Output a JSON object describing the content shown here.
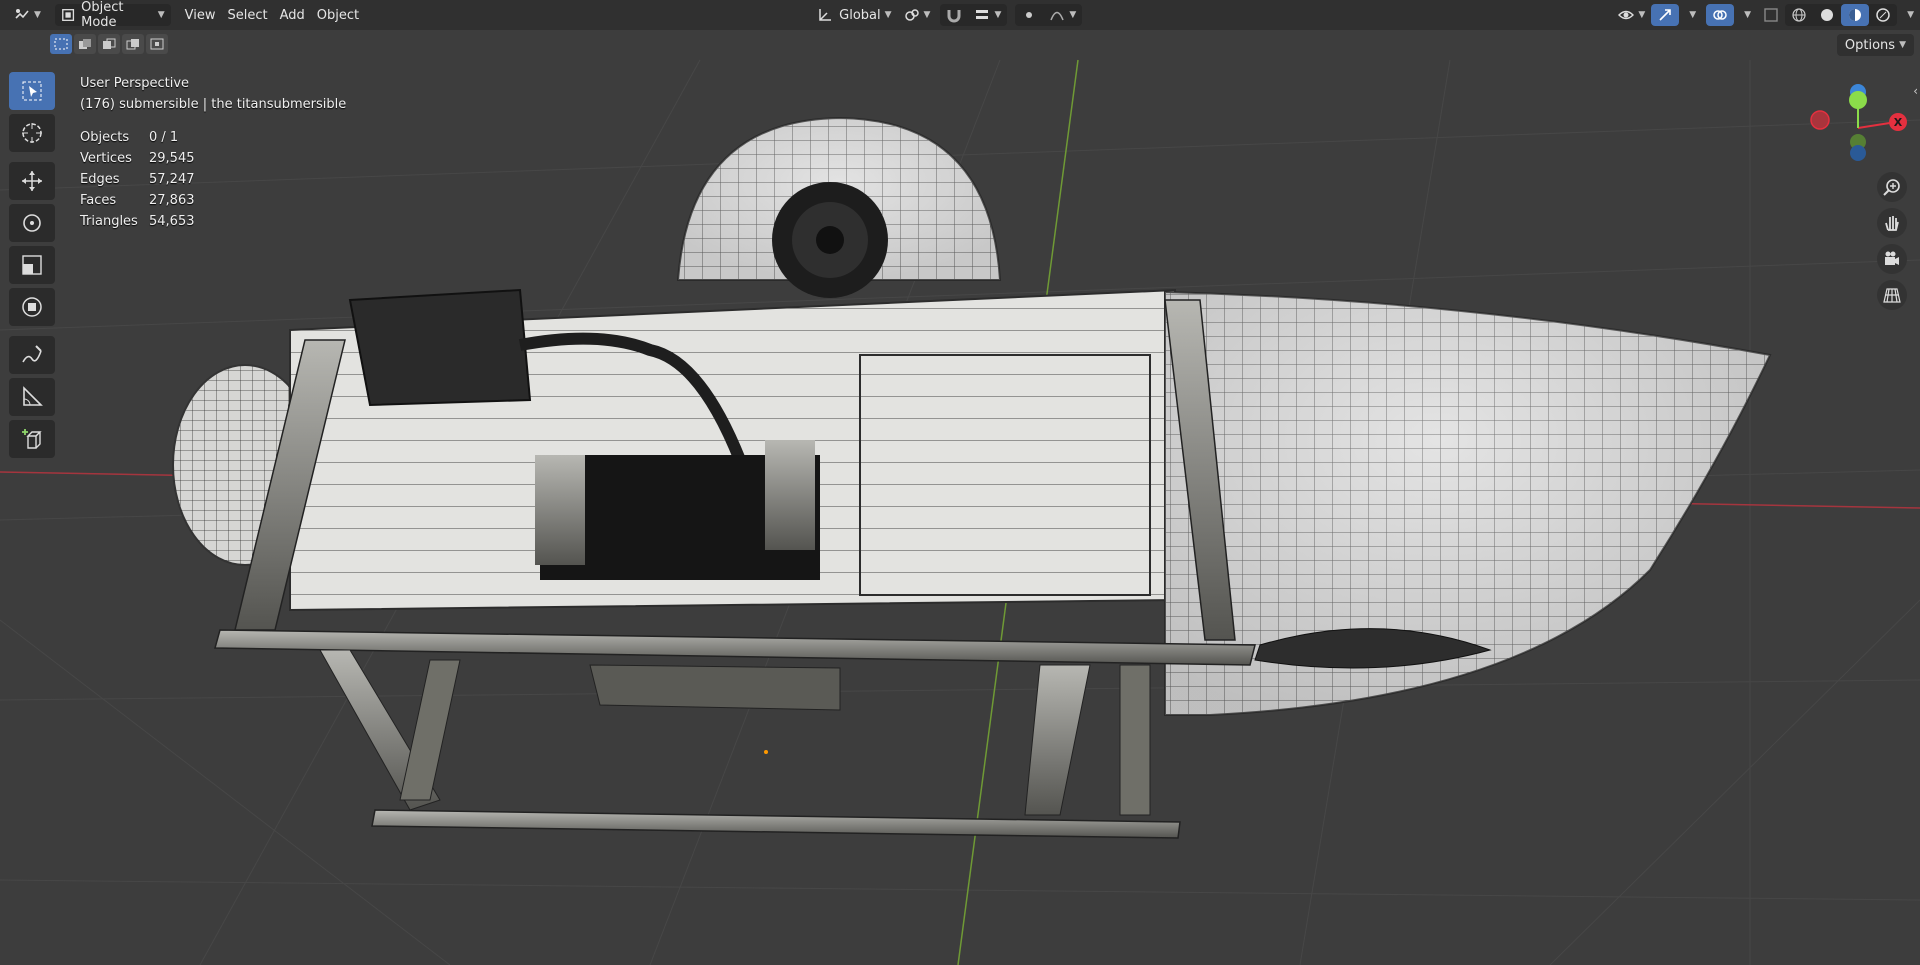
{
  "header": {
    "mode": "Object Mode",
    "menus": [
      "View",
      "Select",
      "Add",
      "Object"
    ],
    "transform_orientation": "Global"
  },
  "options_label": "Options",
  "viewport": {
    "view_name": "User Perspective",
    "object_info": "(176) submersible | the titansubmersible",
    "stats": [
      {
        "label": "Objects",
        "value": "0 / 1"
      },
      {
        "label": "Vertices",
        "value": "29,545"
      },
      {
        "label": "Edges",
        "value": "57,247"
      },
      {
        "label": "Faces",
        "value": "27,863"
      },
      {
        "label": "Triangles",
        "value": "54,653"
      }
    ]
  },
  "gizmo": {
    "x_label": "X",
    "colors": {
      "x": "#e4303f",
      "y": "#8bdc4a",
      "z": "#3c86d8",
      "neg_x": "#a9343c"
    }
  },
  "colors": {
    "accent": "#4772b3",
    "header_bg": "#303030",
    "viewport_bg": "#3d3d3d"
  },
  "icons": {
    "tools": [
      "select-box-icon",
      "cursor-icon",
      "move-icon",
      "rotate-icon",
      "scale-icon",
      "transform-icon",
      "annotate-icon",
      "measure-icon",
      "add-cube-icon"
    ],
    "nav": [
      "zoom-icon",
      "hand-pan-icon",
      "camera-icon",
      "grid-perspective-icon"
    ]
  }
}
